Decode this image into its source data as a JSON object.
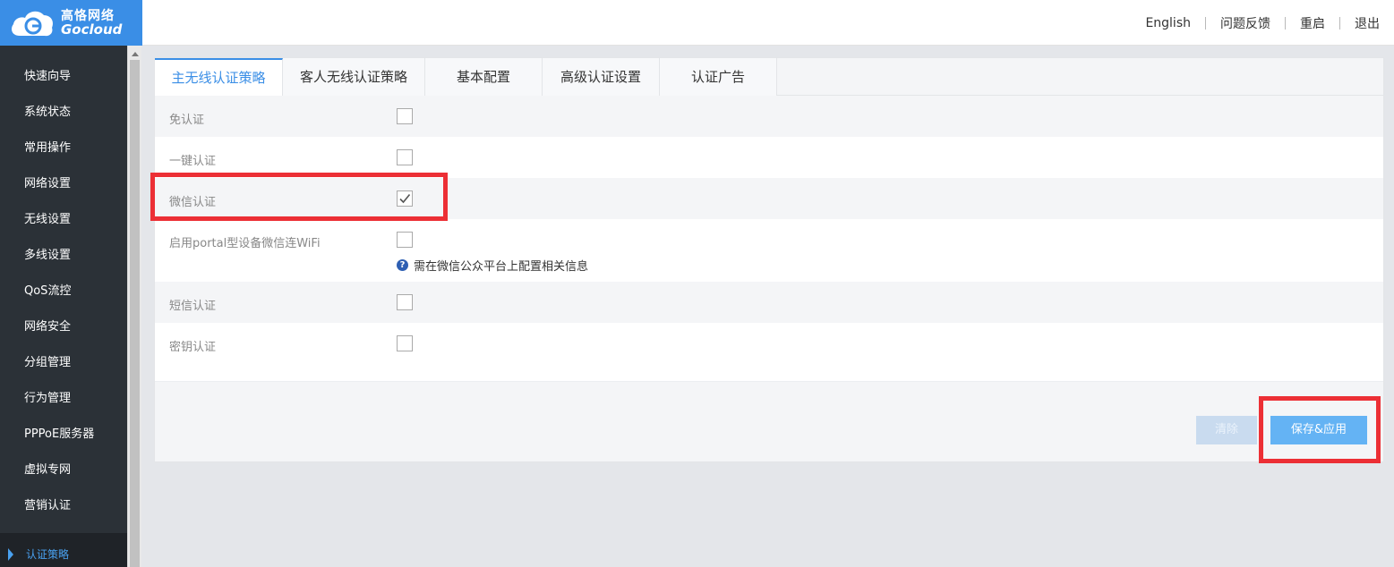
{
  "brand": {
    "name_cn": "高恪网络",
    "name_en": "Gocloud"
  },
  "top_nav": {
    "english": "English",
    "feedback": "问题反馈",
    "restart": "重启",
    "logout": "退出"
  },
  "sidebar": {
    "items": [
      {
        "label": "快速向导"
      },
      {
        "label": "系统状态"
      },
      {
        "label": "常用操作"
      },
      {
        "label": "网络设置"
      },
      {
        "label": "无线设置"
      },
      {
        "label": "多线设置"
      },
      {
        "label": "QoS流控"
      },
      {
        "label": "网络安全"
      },
      {
        "label": "分组管理"
      },
      {
        "label": "行为管理"
      },
      {
        "label": "PPPoE服务器"
      },
      {
        "label": "虚拟专网"
      },
      {
        "label": "营销认证"
      }
    ],
    "active_item": "认证策略"
  },
  "tabs": [
    {
      "label": "主无线认证策略",
      "active": true
    },
    {
      "label": "客人无线认证策略",
      "active": false
    },
    {
      "label": "基本配置",
      "active": false
    },
    {
      "label": "高级认证设置",
      "active": false
    },
    {
      "label": "认证广告",
      "active": false
    }
  ],
  "options": [
    {
      "label": "免认证",
      "checked": false
    },
    {
      "label": "一键认证",
      "checked": false
    },
    {
      "label": "微信认证",
      "checked": true
    },
    {
      "label": "启用portal型设备微信连WiFi",
      "checked": false,
      "hint": "需在微信公众平台上配置相关信息"
    },
    {
      "label": "短信认证",
      "checked": false
    },
    {
      "label": "密钥认证",
      "checked": false
    }
  ],
  "buttons": {
    "clear": "清除",
    "save": "保存&应用"
  },
  "colors": {
    "accent": "#3a8ee6",
    "highlight": "#ec2f35",
    "sidebar_bg": "#2b3137"
  }
}
